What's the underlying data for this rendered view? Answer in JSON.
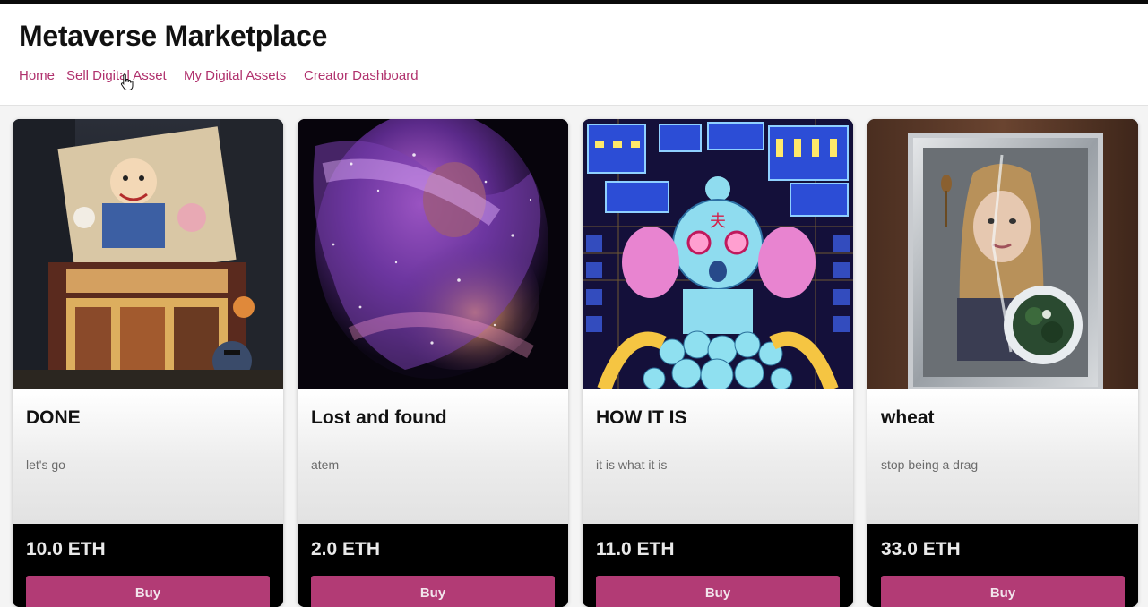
{
  "header": {
    "title": "Metaverse Marketplace",
    "nav": [
      {
        "label": "Home"
      },
      {
        "label": "Sell Digital Asset"
      },
      {
        "label": "My Digital Assets"
      },
      {
        "label": "Creator Dashboard"
      }
    ]
  },
  "colors": {
    "nav_link": "#b0316d",
    "buy_button": "#b23b75",
    "footer_bg": "#000000"
  },
  "cards": [
    {
      "name": "DONE",
      "description": "let's go",
      "price": "10.0 ETH",
      "button": "Buy",
      "image": "anime-street-food-stall-artwork"
    },
    {
      "name": "Lost and found",
      "description": "atem",
      "price": "2.0 ETH",
      "button": "Buy",
      "image": "glittering-cosmic-figures-artwork"
    },
    {
      "name": "HOW IT IS",
      "description": "it is what it is",
      "price": "11.0 ETH",
      "button": "Buy",
      "image": "pixel-art-cyber-creature-artwork"
    },
    {
      "name": "wheat",
      "description": "stop being a drag",
      "price": "33.0 ETH",
      "button": "Buy",
      "image": "portrait-behind-glass-frame-artwork"
    }
  ]
}
